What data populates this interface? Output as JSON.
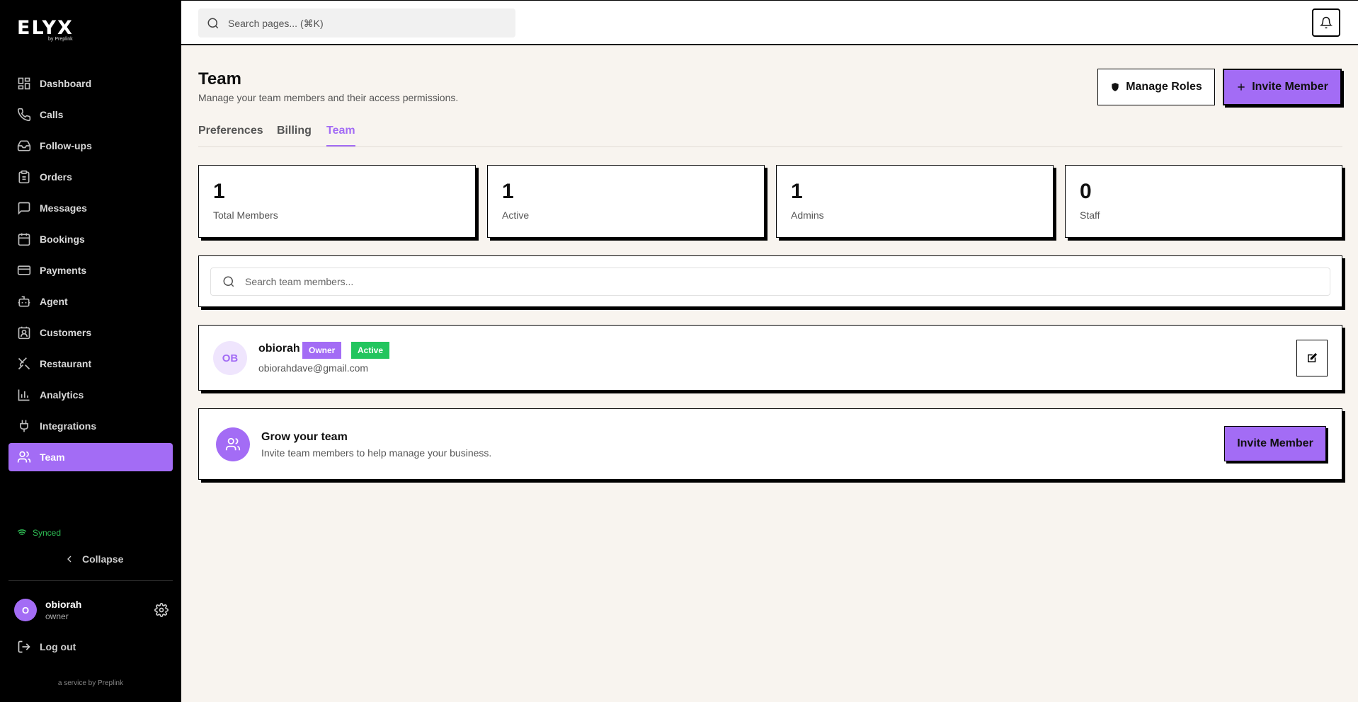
{
  "brand": {
    "name": "ELYX",
    "tagline": "by Preplink"
  },
  "sidebar": {
    "items": [
      {
        "label": "Dashboard",
        "icon": "dashboard-icon"
      },
      {
        "label": "Calls",
        "icon": "phone-icon"
      },
      {
        "label": "Follow-ups",
        "icon": "inbox-icon"
      },
      {
        "label": "Orders",
        "icon": "clipboard-icon"
      },
      {
        "label": "Messages",
        "icon": "message-icon"
      },
      {
        "label": "Bookings",
        "icon": "calendar-icon"
      },
      {
        "label": "Payments",
        "icon": "credit-card-icon"
      },
      {
        "label": "Agent",
        "icon": "bot-icon"
      },
      {
        "label": "Customers",
        "icon": "contact-icon"
      },
      {
        "label": "Restaurant",
        "icon": "utensils-icon"
      },
      {
        "label": "Analytics",
        "icon": "bar-chart-icon"
      },
      {
        "label": "Integrations",
        "icon": "plug-icon"
      },
      {
        "label": "Team",
        "icon": "users-icon",
        "active": true
      }
    ],
    "sync_status": "Synced",
    "collapse_label": "Collapse",
    "user": {
      "initial": "O",
      "name": "obiorah",
      "role": "owner"
    },
    "logout_label": "Log out",
    "service_text": "a service by Preplink"
  },
  "topbar": {
    "search_placeholder": "Search pages... (⌘K)"
  },
  "header": {
    "title": "Team",
    "description": "Manage your team members and their access permissions.",
    "manage_roles_label": "Manage Roles",
    "invite_label": "Invite Member"
  },
  "tabs": [
    {
      "label": "Preferences"
    },
    {
      "label": "Billing"
    },
    {
      "label": "Team",
      "active": true
    }
  ],
  "stats": [
    {
      "value": "1",
      "label": "Total Members"
    },
    {
      "value": "1",
      "label": "Active"
    },
    {
      "value": "1",
      "label": "Admins"
    },
    {
      "value": "0",
      "label": "Staff"
    }
  ],
  "member_search": {
    "placeholder": "Search team members..."
  },
  "members": [
    {
      "initials": "OB",
      "name": "obiorah",
      "role_badge": "Owner",
      "status_badge": "Active",
      "email": "obiorahdave@gmail.com"
    }
  ],
  "grow": {
    "title": "Grow your team",
    "description": "Invite team members to help manage your business.",
    "button_label": "Invite Member"
  },
  "colors": {
    "accent": "#a36cf5",
    "success": "#22c55e",
    "sidebar_bg": "#000000",
    "page_bg": "#f8f4ef"
  }
}
